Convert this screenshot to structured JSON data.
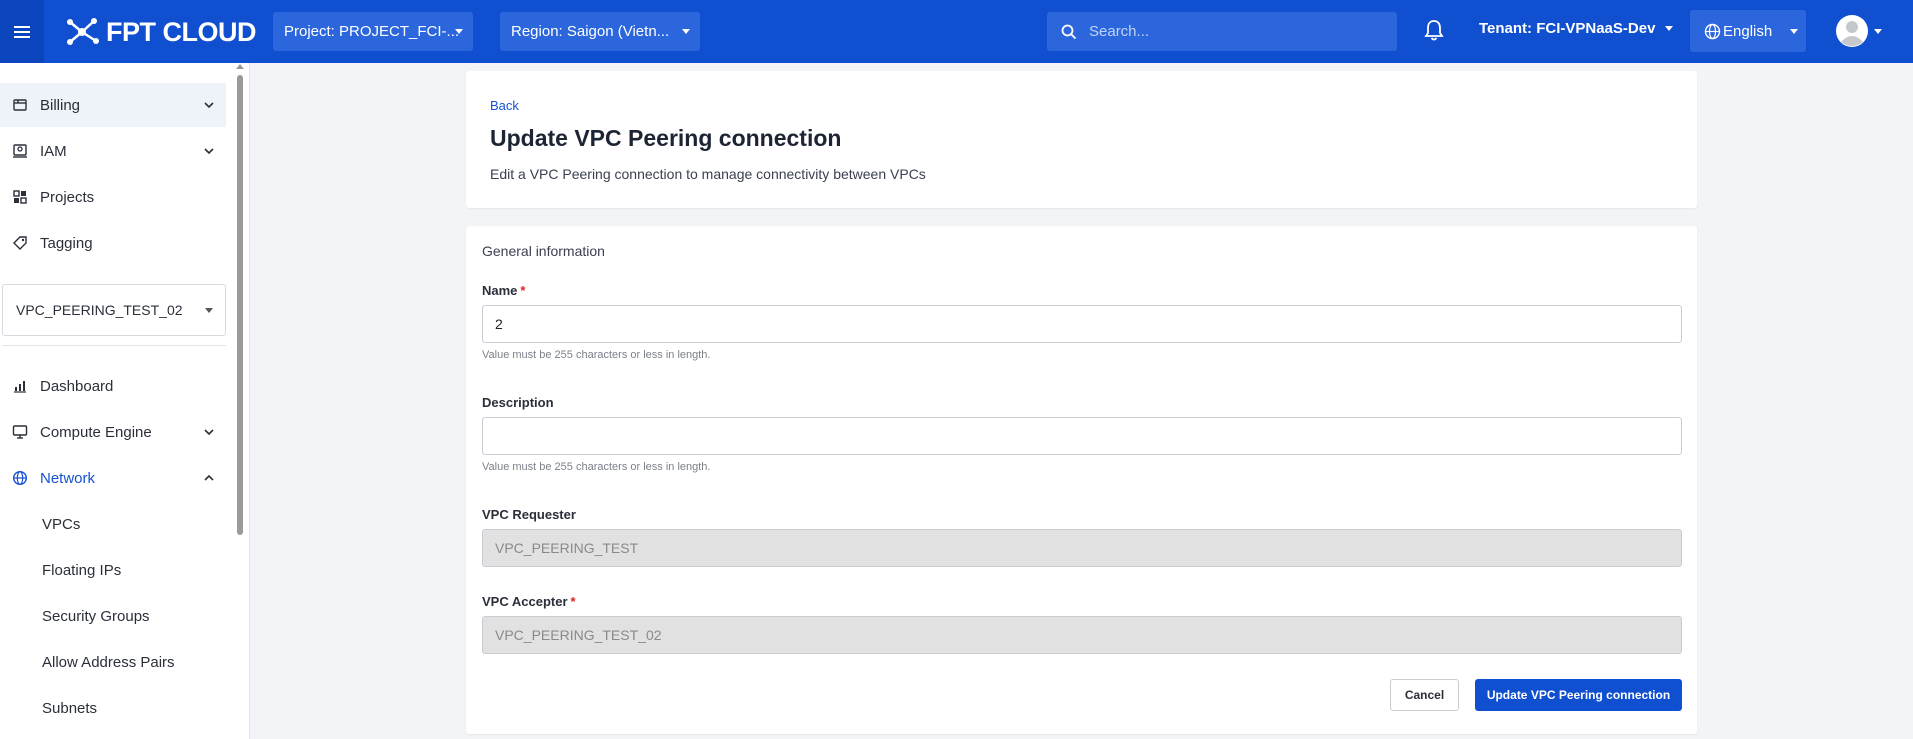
{
  "topbar": {
    "logo_text": "FPT CLOUD",
    "project_label": "Project: PROJECT_FCI-...",
    "region_label": "Region: Saigon (Vietn...",
    "search_placeholder": "Search...",
    "tenant_label": "Tenant: FCI-VPNaaS-Dev",
    "language_label": "English",
    "brand_color": "#0f4fd0"
  },
  "sidebar": {
    "items": [
      {
        "label": "Billing",
        "icon": "billing-icon"
      },
      {
        "label": "IAM",
        "icon": "iam-icon"
      },
      {
        "label": "Projects",
        "icon": "projects-icon"
      },
      {
        "label": "Tagging",
        "icon": "tag-icon"
      }
    ],
    "vpc_selector": "VPC_PEERING_TEST_02",
    "main_items": [
      {
        "label": "Dashboard",
        "icon": "chart-icon"
      },
      {
        "label": "Compute Engine",
        "icon": "monitor-icon"
      },
      {
        "label": "Network",
        "icon": "globe-icon"
      }
    ],
    "network_children": [
      "VPCs",
      "Floating IPs",
      "Security Groups",
      "Allow Address Pairs",
      "Subnets"
    ]
  },
  "header": {
    "back_label": "Back",
    "title": "Update VPC Peering connection",
    "subtitle": "Edit a VPC Peering connection to manage connectivity between VPCs"
  },
  "form": {
    "section_title": "General information",
    "name_label": "Name",
    "name_required": "*",
    "name_value": "2",
    "name_hint": "Value must be 255 characters or less in length.",
    "description_label": "Description",
    "description_value": "",
    "description_hint": "Value must be 255 characters or less in length.",
    "requester_label": "VPC Requester",
    "requester_value": "VPC_PEERING_TEST",
    "accepter_label": "VPC Accepter",
    "accepter_required": "*",
    "accepter_value": "VPC_PEERING_TEST_02",
    "cancel_label": "Cancel",
    "submit_label": "Update VPC Peering connection"
  }
}
